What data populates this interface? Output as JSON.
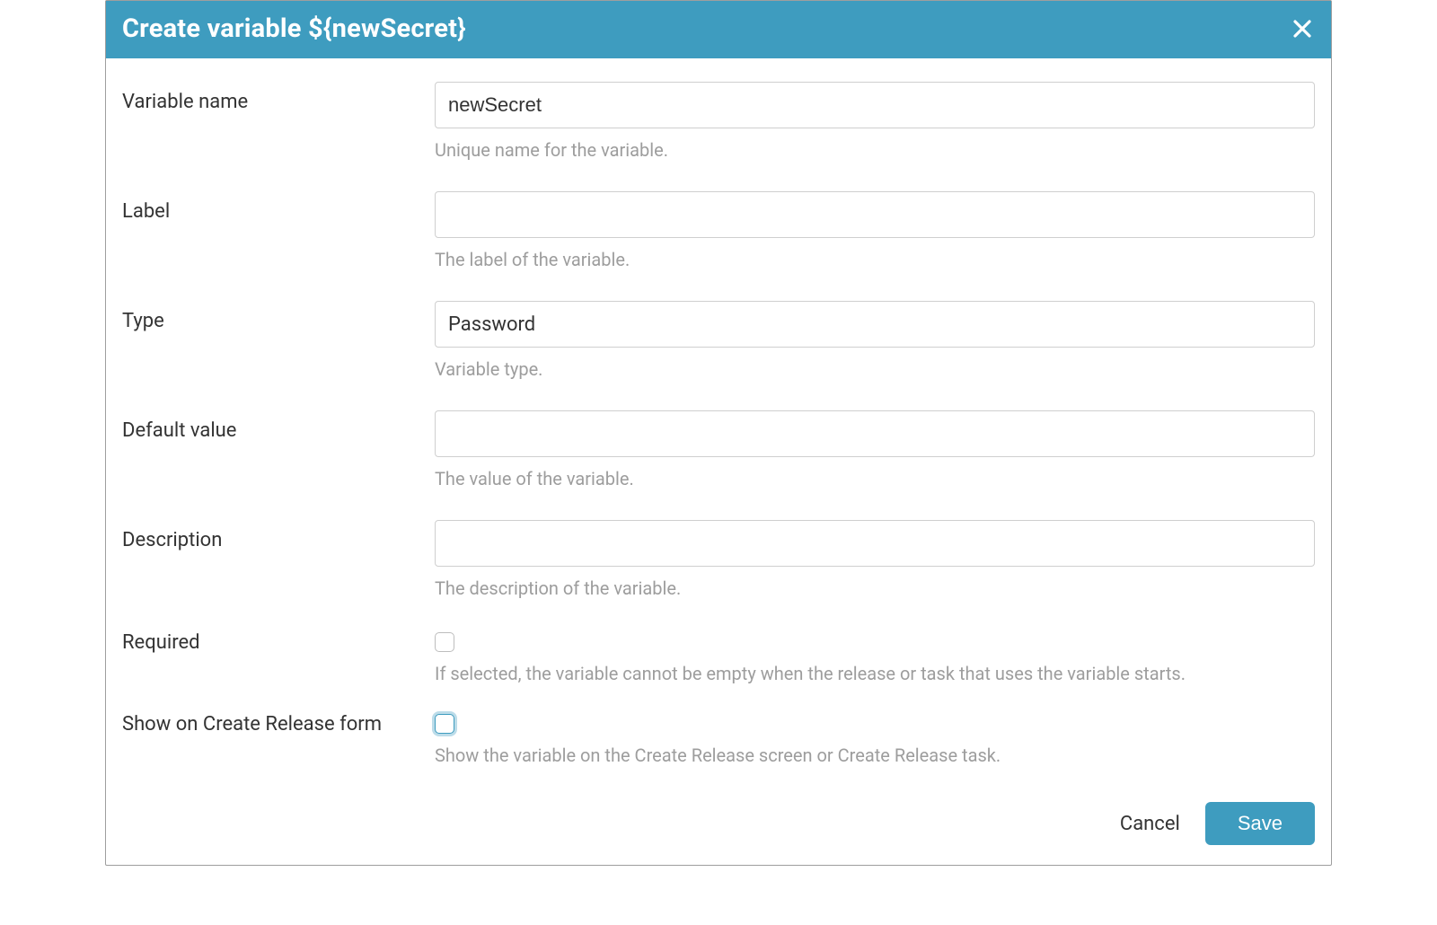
{
  "header": {
    "title": "Create variable ${newSecret}"
  },
  "form": {
    "variable_name": {
      "label": "Variable name",
      "value": "newSecret",
      "help": "Unique name for the variable."
    },
    "label_field": {
      "label": "Label",
      "value": "",
      "help": "The label of the variable."
    },
    "type": {
      "label": "Type",
      "value": "Password",
      "help": "Variable type."
    },
    "default_value": {
      "label": "Default value",
      "value": "",
      "help": "The value of the variable."
    },
    "description": {
      "label": "Description",
      "value": "",
      "help": "The description of the variable."
    },
    "required": {
      "label": "Required",
      "checked": false,
      "help": "If selected, the variable cannot be empty when the release or task that uses the variable starts."
    },
    "show_on_create_release": {
      "label": "Show on Create Release form",
      "checked": false,
      "help": "Show the variable on the Create Release screen or Create Release task."
    }
  },
  "footer": {
    "cancel": "Cancel",
    "save": "Save"
  }
}
